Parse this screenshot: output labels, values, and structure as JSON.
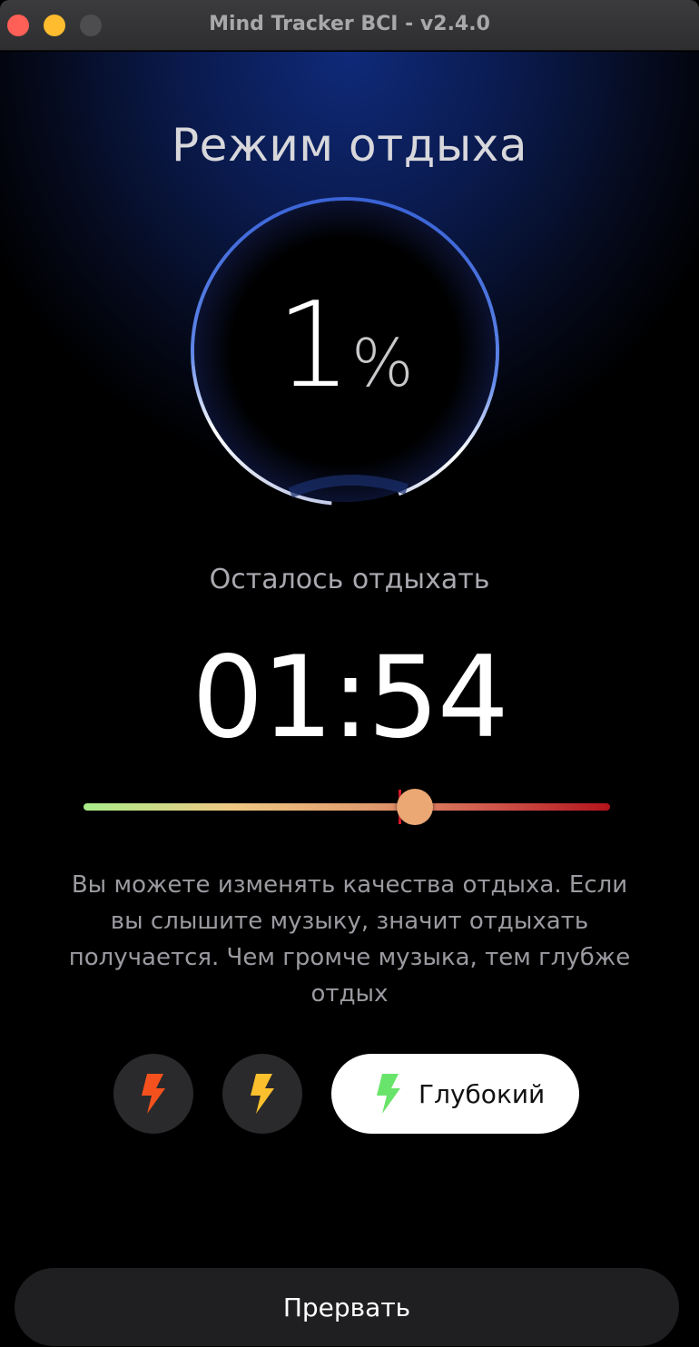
{
  "window": {
    "title": "Mind Tracker BCI - v2.4.0"
  },
  "session": {
    "mode_title": "Режим отдыха",
    "progress_value": "1",
    "progress_unit": "%",
    "progress_fraction": 0.01,
    "remaining_label": "Осталось отдыхать",
    "timer": "01:54"
  },
  "quality_slider": {
    "value_fraction": 0.63,
    "marker_fraction": 0.6,
    "colors": [
      "#a9ed8a",
      "#efc883",
      "#e19a6c",
      "#d0544a",
      "#b3141b"
    ],
    "thumb_color": "#eba774"
  },
  "description": "Вы можете изменять качества отдыха. Если вы слышите музыку, значит отдыхать получается. Чем громче музыка, тем глубже отдых",
  "modes": [
    {
      "icon": "lightning-icon",
      "color": "#f4511e",
      "label": ""
    },
    {
      "icon": "lightning-icon",
      "color": "#fbc02d",
      "label": ""
    },
    {
      "icon": "lightning-icon",
      "color": "#69e46a",
      "label": "Глубокий",
      "selected": true
    }
  ],
  "actions": {
    "stop_label": "Прервать"
  }
}
